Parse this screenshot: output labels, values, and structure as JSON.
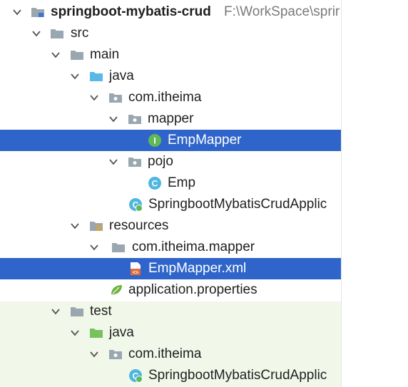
{
  "project": {
    "name": "springboot-mybatis-crud",
    "path": "F:\\WorkSpace\\sprir"
  },
  "tree": {
    "src": "src",
    "main": "main",
    "java_main": "java",
    "pkg_main": "com.itheima",
    "mapper_pkg": "mapper",
    "emp_mapper": "EmpMapper",
    "pojo_pkg": "pojo",
    "emp": "Emp",
    "app_class": "SpringbootMybatisCrudApplic",
    "resources": "resources",
    "res_pkg": "com.itheima.mapper",
    "mapper_xml": "EmpMapper.xml",
    "app_props": "application.properties",
    "test": "test",
    "java_test": "java",
    "pkg_test": "com.itheima",
    "test_class": "SpringbootMybatisCrudApplic"
  },
  "colors": {
    "selection": "#2f65ca",
    "folder": "#9aa7b0",
    "source_folder": "#5ab8e8",
    "test_folder": "#76c25c",
    "class_icon": "#4fb6e0",
    "interface_icon": "#5fb85a",
    "xml_icon": "#e06d3c",
    "test_tint": "#f1f8ea"
  },
  "icons": [
    "chevron-down-icon",
    "module-folder-icon",
    "folder-icon",
    "source-folder-icon",
    "package-icon",
    "interface-icon",
    "class-icon",
    "spring-class-icon",
    "resources-folder-icon",
    "xml-file-icon",
    "properties-leaf-icon",
    "test-source-folder-icon"
  ]
}
